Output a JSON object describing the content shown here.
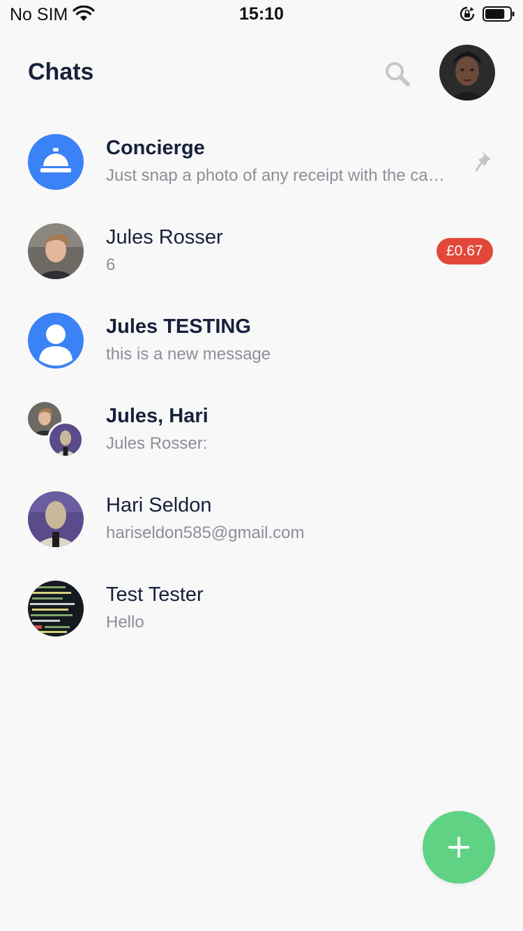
{
  "status_bar": {
    "carrier": "No SIM",
    "time": "15:10",
    "battery_level": 0.8
  },
  "header": {
    "title": "Chats",
    "search_icon": "search-icon",
    "profile_icon": "profile-avatar"
  },
  "chats": [
    {
      "name": "Concierge",
      "preview": "Just snap a photo of any receipt with the camera",
      "bold": true,
      "pinned": true,
      "avatar": "bell-icon",
      "accent": "#3b82f6"
    },
    {
      "name": "Jules Rosser",
      "preview": "6",
      "bold": false,
      "badge": "£0.67",
      "badge_color": "#e2483a",
      "avatar": "person-photo"
    },
    {
      "name": "Jules TESTING",
      "preview": "this is a new message",
      "bold": true,
      "avatar": "default-user-icon",
      "accent": "#3b82f6"
    },
    {
      "name": "Jules, Hari",
      "preview": "Jules Rosser:",
      "bold": true,
      "avatar": "group-photo"
    },
    {
      "name": "Hari Seldon",
      "preview": "hariseldon585@gmail.com",
      "bold": false,
      "avatar": "person-photo"
    },
    {
      "name": "Test Tester",
      "preview": "Hello",
      "bold": false,
      "avatar": "terminal-photo"
    }
  ],
  "fab": {
    "icon": "plus-icon",
    "color": "#5fd383"
  }
}
